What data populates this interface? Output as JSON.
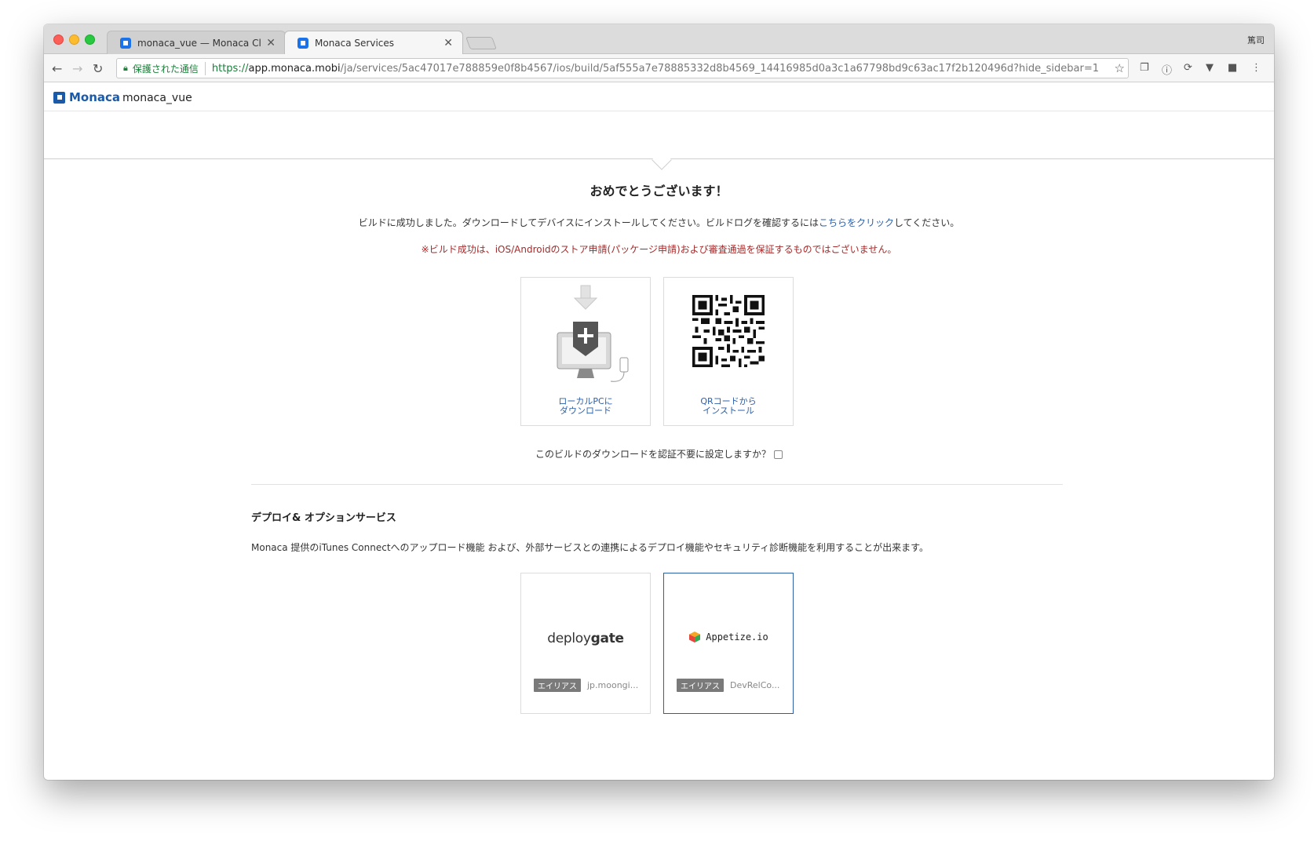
{
  "browser": {
    "tabs": [
      {
        "title": "monaca_vue — Monaca Cloud IDE",
        "active": false
      },
      {
        "title": "Monaca Services",
        "active": true
      }
    ],
    "profile_name": "篤司",
    "security_label": "保護された通信",
    "url_scheme": "https://",
    "url_host": "app.monaca.mobi",
    "url_path": "/ja/services/5ac47017e788859e0f8b4567/ios/build/5af555a7e78885332d8b4569_14416985d0a3c1a67798bd9c63ac17f2b120496d?hide_sidebar=1"
  },
  "app_header": {
    "logo_text": "Monaca",
    "project_name": "monaca_vue"
  },
  "result": {
    "title": "おめでとうございます！",
    "message_before": "ビルドに成功しました。ダウンロードしてデバイスにインストールしてください。ビルドログを確認するには",
    "message_link": "こちらをクリック",
    "message_after": "してください。",
    "warning": "※ビルド成功は、iOS/Androidのストア申請(パッケージ申請)および審査通過を保証するものではございません。"
  },
  "install_options": {
    "download_label_1": "ローカルPCに",
    "download_label_2": "ダウンロード",
    "qr_label_1": "QRコードから",
    "qr_label_2": "インストール"
  },
  "auth": {
    "label": "このビルドのダウンロードを認証不要に設定しますか？",
    "checked": false
  },
  "deploy": {
    "title": "デプロイ& オプションサービス",
    "description": "Monaca 提供のiTunes Connectへのアップロード機能 および、外部サービスとの連携によるデプロイ機能やセキュリティ診断機能を利用することが出来ます。",
    "services": [
      {
        "logo_a": "deploy",
        "logo_b": "gate",
        "alias_badge": "エイリアス",
        "alias_value": "jp.moongi..."
      },
      {
        "logo": "Appetize.io",
        "alias_badge": "エイリアス",
        "alias_value": "DevRelCo..."
      }
    ]
  }
}
